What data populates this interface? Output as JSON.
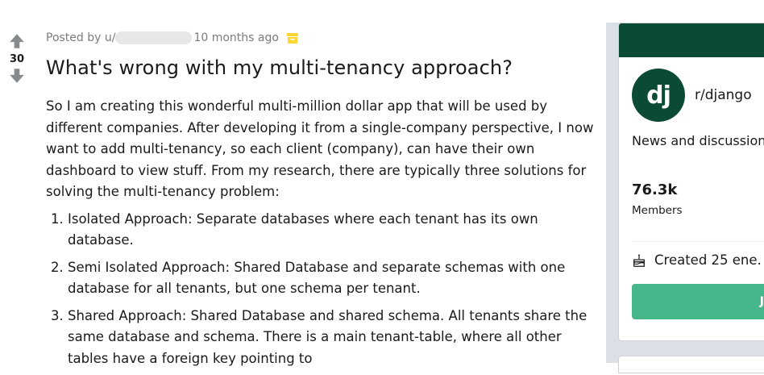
{
  "post": {
    "score": "30",
    "meta_prefix": "Posted by u/",
    "meta_time": "10 months ago",
    "title": "What's wrong with my multi-tenancy approach?",
    "body_intro": "So I am creating this wonderful multi-million dollar app that will be used by different companies. After developing it from a single-company perspective, I now want to add multi-tenancy, so each client (company), can have their own dashboard to view stuff. From my research, there are typically three solutions for solving the multi-tenancy problem:",
    "list": [
      "Isolated Approach: Separate databases where each tenant has its own database.",
      "Semi Isolated Approach: Shared Database and separate schemas with one database for all tenants, but one schema per tenant.",
      "Shared Approach: Shared Database and shared schema. All tenants share the same database and schema. There is a main tenant-table, where all other tables have a foreign key pointing to"
    ]
  },
  "sidebar": {
    "logo_text": "dj",
    "subreddit": "r/django",
    "description": "News and discussion about the Django web framework.",
    "members_count": "76.3k",
    "members_label": "Members",
    "created": "Created 25 ene.",
    "join_label": "J"
  },
  "colors": {
    "header": "#0c4b33",
    "join": "#46b78a",
    "archive": "#ffd635"
  },
  "icons": {
    "upvote": "arrow-up-icon",
    "downvote": "arrow-down-icon",
    "archive": "archive-icon",
    "cake": "cake-icon"
  }
}
